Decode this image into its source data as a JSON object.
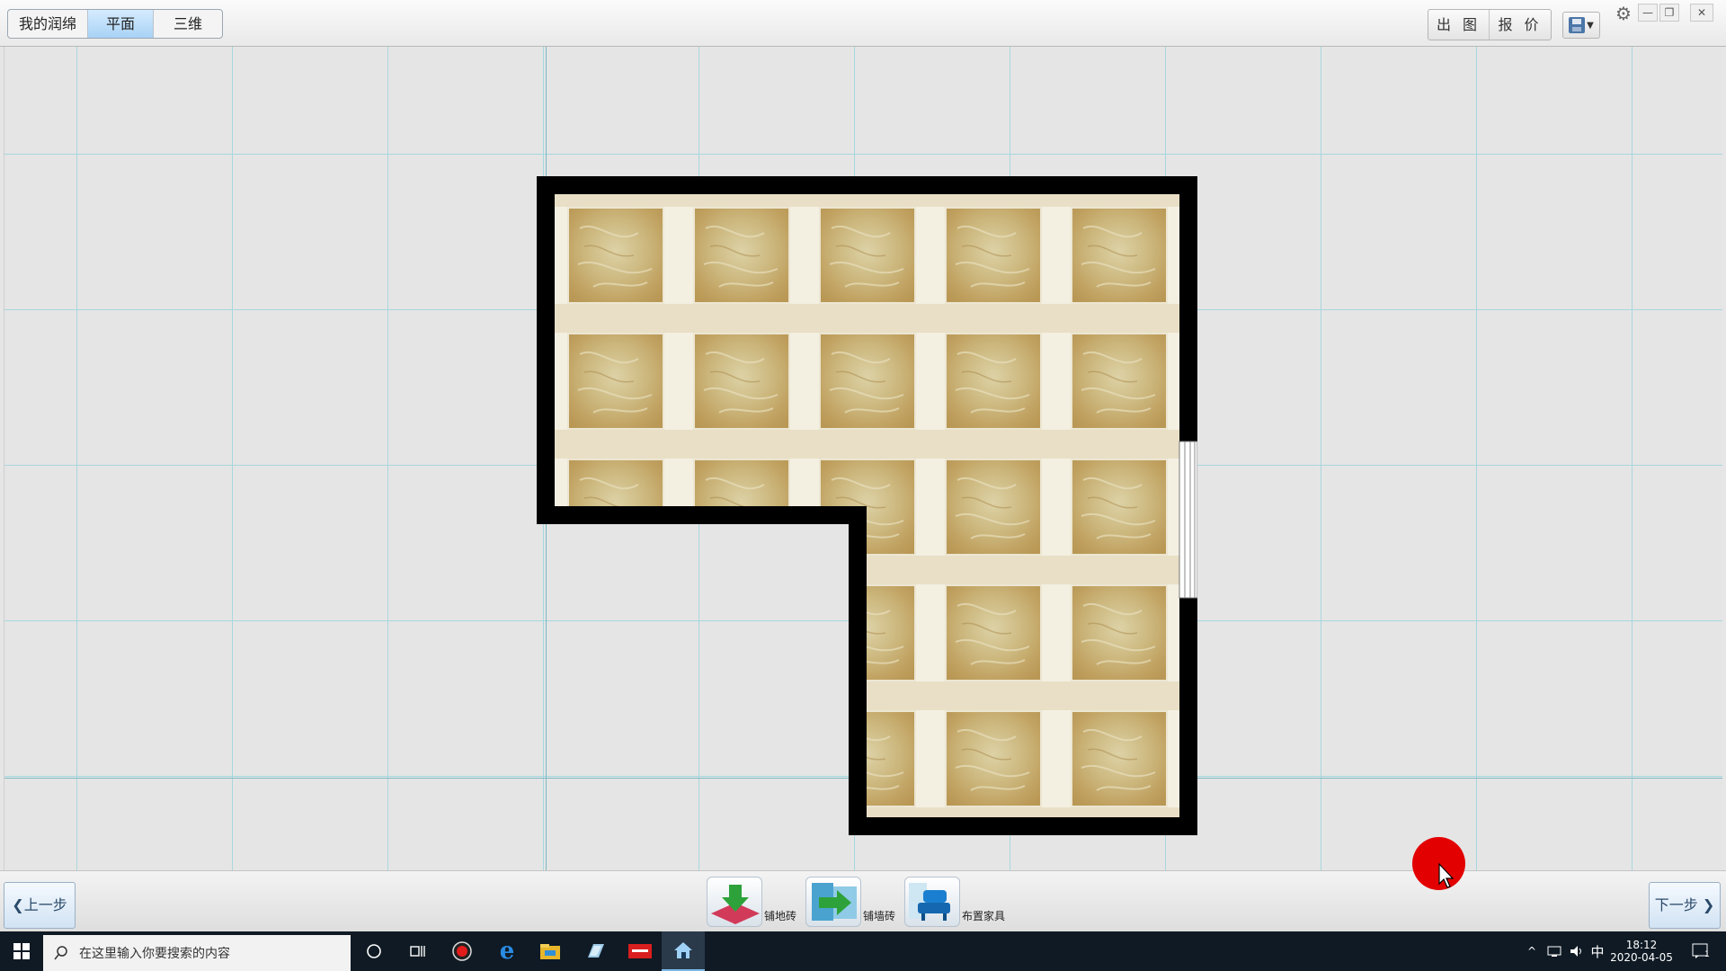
{
  "toolbar": {
    "modes": [
      "我的润绵",
      "平面",
      "三维"
    ],
    "active_mode": "平面",
    "export_label": "出 图",
    "quote_label": "报 价"
  },
  "floorplan": {
    "tile_pattern": "marble tile with light border grout",
    "wall_color": "#000000",
    "grid_color": "#a7d7de"
  },
  "bottom": {
    "prev_label": "❮上一步",
    "next_label": "下一步 ❯",
    "tools": [
      {
        "label": "铺地砖",
        "icon": "floor-tile-icon"
      },
      {
        "label": "铺墙砖",
        "icon": "wall-tile-icon"
      },
      {
        "label": "布置家具",
        "icon": "furniture-icon"
      }
    ]
  },
  "taskbar": {
    "search_placeholder": "在这里输入你要搜索的内容",
    "time": "18:12",
    "date": "2020-04-05",
    "ime": "中",
    "notifications": "1"
  }
}
